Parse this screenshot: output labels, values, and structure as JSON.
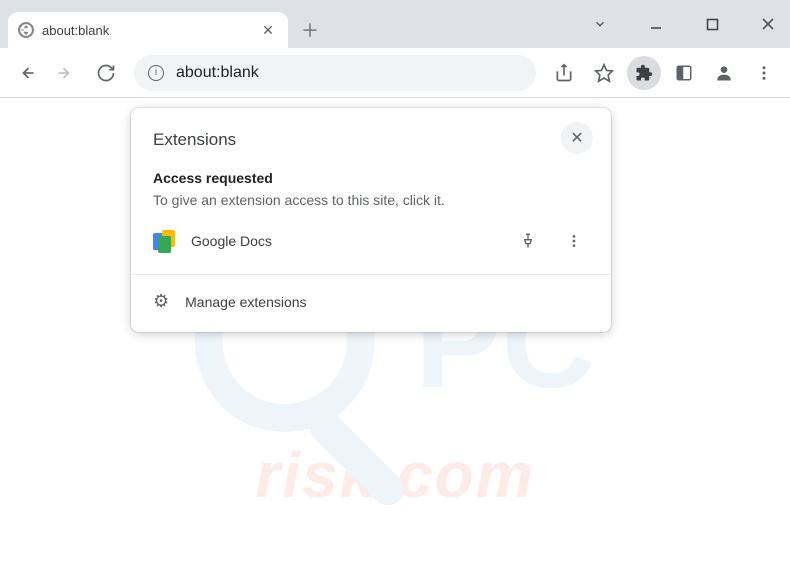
{
  "tab": {
    "title": "about:blank"
  },
  "url": "about:blank",
  "popup": {
    "title": "Extensions",
    "section_title": "Access requested",
    "section_desc": "To give an extension access to this site, click it.",
    "items": {
      "0": {
        "name": "Google Docs"
      }
    },
    "manage_label": "Manage extensions"
  },
  "watermark_text": "risk.com"
}
